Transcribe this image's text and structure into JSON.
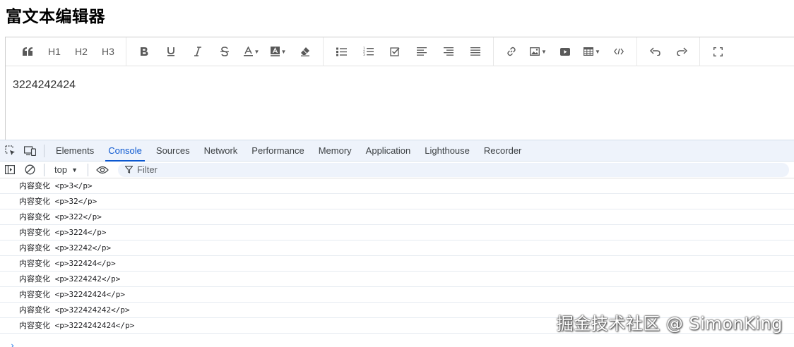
{
  "page": {
    "title": "富文本编辑器"
  },
  "toolbar": {
    "groups": [
      [
        {
          "name": "blockquote-icon",
          "label": ""
        },
        {
          "name": "h1-button",
          "label": "H1"
        },
        {
          "name": "h2-button",
          "label": "H2"
        },
        {
          "name": "h3-button",
          "label": "H3"
        }
      ],
      [
        {
          "name": "bold-icon"
        },
        {
          "name": "underline-icon"
        },
        {
          "name": "italic-icon"
        },
        {
          "name": "strikethrough-icon"
        },
        {
          "name": "font-color-icon"
        },
        {
          "name": "bg-color-icon"
        },
        {
          "name": "clear-format-icon"
        }
      ],
      [
        {
          "name": "bulleted-list-icon"
        },
        {
          "name": "numbered-list-icon"
        },
        {
          "name": "todo-icon"
        },
        {
          "name": "align-left-icon"
        },
        {
          "name": "align-right-icon"
        },
        {
          "name": "justify-icon"
        }
      ],
      [
        {
          "name": "link-icon"
        },
        {
          "name": "image-icon"
        },
        {
          "name": "video-icon"
        },
        {
          "name": "table-icon"
        },
        {
          "name": "code-icon"
        }
      ],
      [
        {
          "name": "undo-icon"
        },
        {
          "name": "redo-icon"
        }
      ],
      [
        {
          "name": "fullscreen-icon"
        }
      ]
    ],
    "h1": "H1",
    "h2": "H2",
    "h3": "H3"
  },
  "editor": {
    "content": "3224242424"
  },
  "devtools": {
    "tabs": [
      "Elements",
      "Console",
      "Sources",
      "Network",
      "Performance",
      "Memory",
      "Application",
      "Lighthouse",
      "Recorder"
    ],
    "active_tab": "Console",
    "context": "top",
    "filter_placeholder": "Filter",
    "logs": [
      "内容变化 <p>3</p>",
      "内容变化 <p>32</p>",
      "内容变化 <p>322</p>",
      "内容变化 <p>3224</p>",
      "内容变化 <p>32242</p>",
      "内容变化 <p>322424</p>",
      "内容变化 <p>3224242</p>",
      "内容变化 <p>32242424</p>",
      "内容变化 <p>322424242</p>",
      "内容变化 <p>3224242424</p>"
    ],
    "prompt": "›"
  },
  "watermark": "掘金技术社区 @ SimonKing"
}
